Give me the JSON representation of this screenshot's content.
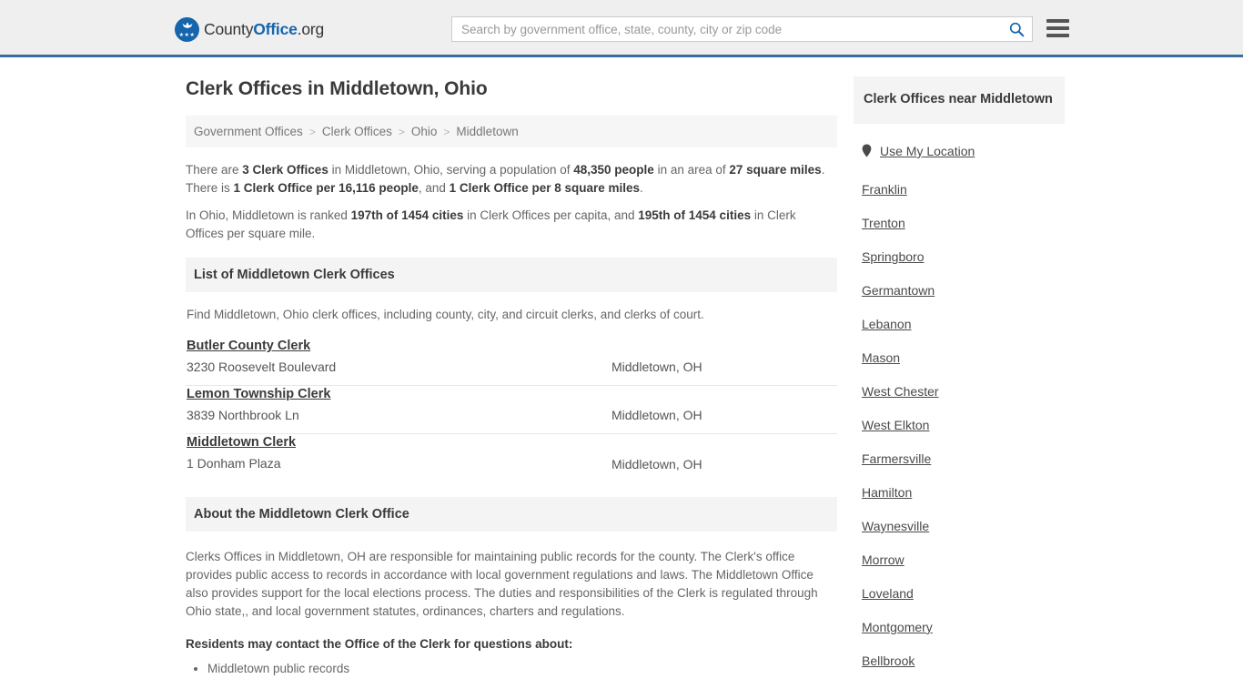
{
  "header": {
    "logo": {
      "text_county": "County",
      "text_office": "Office",
      "text_org": ".org",
      "stars": "★★★"
    },
    "search": {
      "placeholder": "Search by government office, state, county, city or zip code",
      "value": ""
    },
    "accent_color": "#3b6e9c",
    "brand_blue": "#1565ad"
  },
  "main": {
    "title": "Clerk Offices in Middletown, Ohio",
    "breadcrumb": {
      "items": [
        "Government Offices",
        "Clerk Offices",
        "Ohio",
        "Middletown"
      ],
      "separator": ">"
    },
    "stats": {
      "line1_pre": "There are ",
      "line1_b1": "3 Clerk Offices",
      "line1_mid1": " in Middletown, Ohio, serving a population of ",
      "line1_b2": "48,350 people",
      "line1_mid2": " in an area of ",
      "line1_b3": "27 square miles",
      "line1_mid3": ". There is ",
      "line1_b4": "1 Clerk Office per 16,116 people",
      "line1_mid4": ", and ",
      "line1_b5": "1 Clerk Office per 8 square miles",
      "line1_end": ".",
      "line2_pre": "In Ohio, Middletown is ranked ",
      "line2_b1": "197th of 1454 cities",
      "line2_mid": " in Clerk Offices per capita, and ",
      "line2_b2": "195th of 1454 cities",
      "line2_end": " in Clerk Offices per square mile."
    },
    "list_section": {
      "heading": "List of Middletown Clerk Offices",
      "intro": "Find Middletown, Ohio clerk offices, including county, city, and circuit clerks, and clerks of court.",
      "offices": [
        {
          "name": "Butler County Clerk",
          "address": "3230 Roosevelt Boulevard",
          "city": "Middletown, OH"
        },
        {
          "name": "Lemon Township Clerk",
          "address": "3839 Northbrook Ln",
          "city": "Middletown, OH"
        },
        {
          "name": "Middletown Clerk",
          "address": "1 Donham Plaza",
          "city": "Middletown, OH"
        }
      ]
    },
    "about_section": {
      "heading": "About the Middletown Clerk Office",
      "body": "Clerks Offices in Middletown, OH are responsible for maintaining public records for the county. The Clerk's office provides public access to records in accordance with local government regulations and laws. The Middletown Office also provides support for the local elections process. The duties and responsibilities of the Clerk is regulated through Ohio state,, and local government statutes, ordinances, charters and regulations.",
      "subheading": "Residents may contact the Office of the Clerk for questions about:",
      "items": [
        "Middletown public records"
      ]
    }
  },
  "sidebar": {
    "heading": "Clerk Offices near Middletown",
    "use_my_location": "Use My Location",
    "cities": [
      "Franklin",
      "Trenton",
      "Springboro",
      "Germantown",
      "Lebanon",
      "Mason",
      "West Chester",
      "West Elkton",
      "Farmersville",
      "Hamilton",
      "Waynesville",
      "Morrow",
      "Loveland",
      "Montgomery",
      "Bellbrook"
    ]
  }
}
